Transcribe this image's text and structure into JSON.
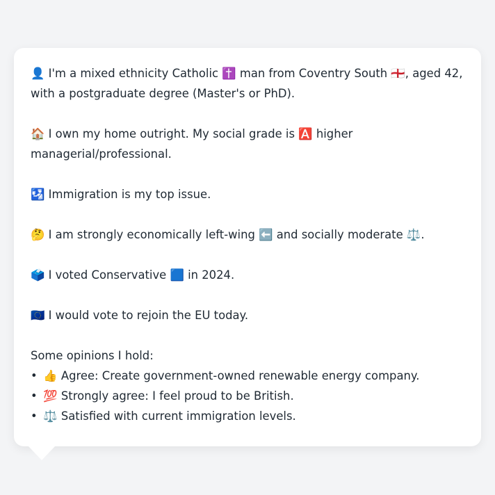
{
  "profile": {
    "identity_emoji": "👤",
    "identity_text": "I'm a mixed ethnicity Catholic ✝️ man from Coventry South 🏴󠁧󠁢󠁥󠁮󠁧󠁿, aged 42, with a postgraduate degree (Master's or PhD).",
    "housing_emoji": "🏠",
    "housing_text": "I own my home outright. My social grade is 🅰️ higher managerial/professional.",
    "issue_emoji": "🛂",
    "issue_text": "Immigration is my top issue.",
    "ideology_emoji": "🤔",
    "ideology_text": "I am strongly economically left-wing ⬅️ and socially moderate ⚖️.",
    "vote_emoji": "🗳️",
    "vote_text": "I voted Conservative 🟦 in 2024.",
    "eu_emoji": "🇪🇺",
    "eu_text": "I would vote to rejoin the EU today."
  },
  "opinions": {
    "title": "Some opinions I hold:",
    "bullet": "•",
    "items": [
      {
        "emoji": "👍",
        "text": "Agree: Create government-owned renewable energy company."
      },
      {
        "emoji": "💯",
        "text": "Strongly agree: I feel proud to be British."
      },
      {
        "emoji": "⚖️",
        "text": "Satisfied with current immigration levels."
      }
    ]
  }
}
